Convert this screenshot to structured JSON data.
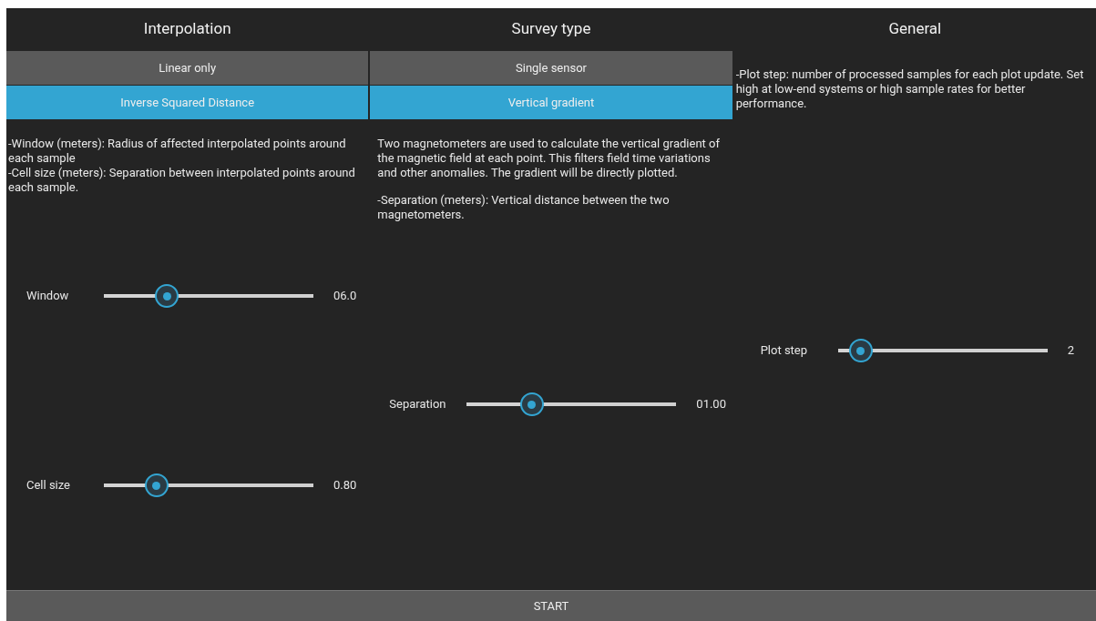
{
  "columns": [
    {
      "title": "Interpolation",
      "options": [
        {
          "label": "Linear only",
          "selected": false
        },
        {
          "label": "Inverse Squared Distance",
          "selected": true
        }
      ],
      "description": [
        "-Window (meters): Radius of affected interpolated points around each sample",
        "-Cell size (meters): Separation between interpolated points around each sample."
      ],
      "sliders": [
        {
          "label": "Window",
          "level": 0.3,
          "reading": "06.0"
        },
        {
          "label": "Cell size",
          "level": 0.25,
          "reading": "0.80"
        }
      ]
    },
    {
      "title": "Survey type",
      "options": [
        {
          "label": "Single sensor",
          "selected": false
        },
        {
          "label": "Vertical gradient",
          "selected": true
        }
      ],
      "description": [
        "Two magnetometers are used to calculate the vertical gradient of the magnetic field at each point. This filters field time variations and other anomalies. The gradient will be directly plotted.",
        "-Separation (meters): Vertical distance between the two magnetometers."
      ],
      "sliders": [
        {
          "label": "Separation",
          "level": 0.31,
          "reading": "01.00"
        }
      ]
    },
    {
      "title": "General",
      "description": [
        "-Plot step: number of processed samples for each plot update. Set high at low-end systems or high sample rates for better performance."
      ],
      "sliders": [
        {
          "label": "Plot step",
          "level": 0.11,
          "reading": "2"
        }
      ]
    }
  ],
  "start_button": {
    "label": "START"
  }
}
